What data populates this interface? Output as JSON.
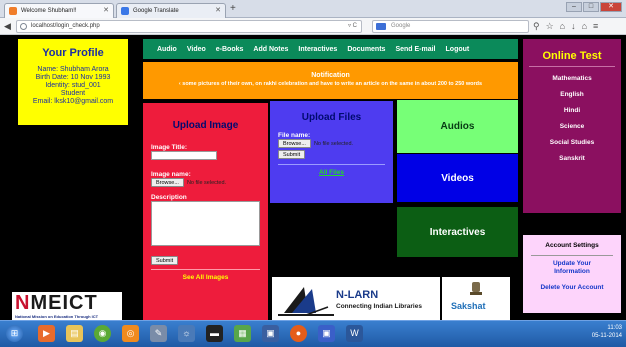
{
  "browser": {
    "tabs": [
      {
        "label": "Welcome Shubham!!",
        "active": true
      },
      {
        "label": "Google Translate",
        "active": false
      }
    ],
    "new_tab": "+",
    "url": "localhost/login_check.php",
    "search_placeholder": "Google",
    "toolbar_icons": [
      "bookmark-icon",
      "star-icon",
      "home-icon",
      "download-icon",
      "menu-icon"
    ]
  },
  "profile": {
    "title": "Your Profile",
    "name": "Name: Shubham Arora",
    "dob": "Birth Date: 10 Nov 1993",
    "identity": "Identity: stud_001",
    "role": "Student",
    "email": "Email: lksk10@gmail.com"
  },
  "menu": {
    "items": [
      "Audio",
      "Video",
      "e-Books",
      "Add Notes",
      "Interactives",
      "Documents",
      "Send E-mail",
      "Logout"
    ]
  },
  "notification": {
    "title": "Notification",
    "message": "‹ some pictures of their own, on rakhi celebration and have to write an article on the same in about 200 to 250 words"
  },
  "upload_image": {
    "title": "Upload Image",
    "image_title_label": "Image Title:",
    "image_name_label": "Image name:",
    "browse": "Browse...",
    "no_file": "No file selected.",
    "description_label": "Description",
    "submit": "Submit",
    "see_all": "See All Images"
  },
  "upload_files": {
    "title": "Upload Files",
    "file_name_label": "File name:",
    "browse": "Browse...",
    "no_file": "No file selected.",
    "submit": "Submit",
    "all_files": "All Files"
  },
  "tiles": {
    "audios": "Audios",
    "videos": "Videos",
    "interactives": "Interactives"
  },
  "online_test": {
    "title": "Online Test",
    "subjects": [
      "Mathematics",
      "English",
      "Hindi",
      "Science",
      "Social Studies",
      "Sanskrit"
    ]
  },
  "account": {
    "title": "Account Settings",
    "update": "Update Your Information",
    "delete": "Delete Your Account"
  },
  "logos": {
    "nmeict_n": "N",
    "nmeict_rest": "MEICT",
    "nmeict_tagline": "National Mission on Education Through ICT",
    "nlarn_title": "N-LARN",
    "nlarn_tagline": "Connecting Indian Libraries",
    "sakshat": "Sakshat"
  },
  "taskbar": {
    "time": "11:03",
    "date": "05-11-2014"
  },
  "colors": {
    "menu_green": "#0b8a5a",
    "notice_orange": "#ff9900",
    "upload_image_red": "#ee1c3c",
    "upload_files_blue": "#4e3cf0",
    "online_test_purple": "#8b1060"
  }
}
